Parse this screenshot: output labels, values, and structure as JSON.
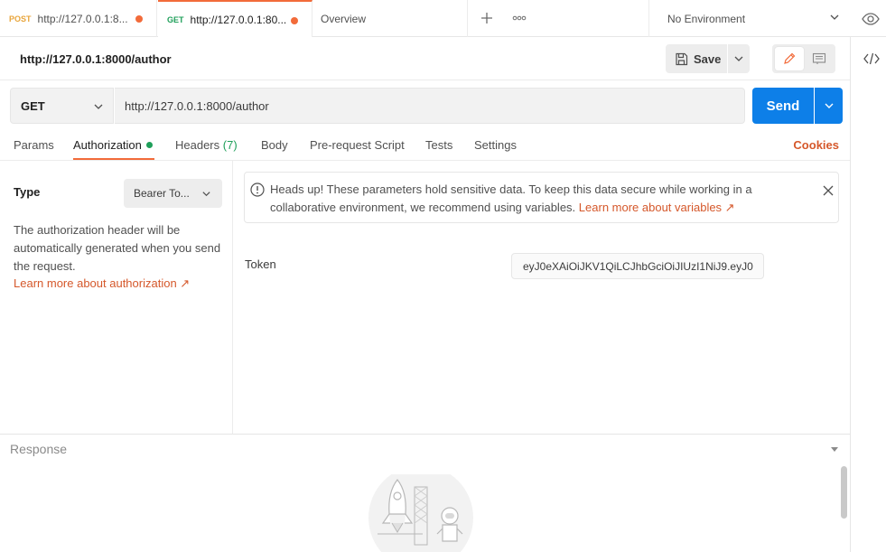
{
  "tabs": [
    {
      "method": "POST",
      "label": "http://127.0.0.1:8..."
    },
    {
      "method": "GET",
      "label": "http://127.0.0.1:80..."
    },
    {
      "label": "Overview"
    }
  ],
  "environment": {
    "label": "No Environment"
  },
  "request": {
    "title": "http://127.0.0.1:8000/author",
    "save_label": "Save",
    "method": "GET",
    "url": "http://127.0.0.1:8000/author",
    "send_label": "Send"
  },
  "subtabs": {
    "params": "Params",
    "authorization": "Authorization",
    "headers": "Headers",
    "headers_count": "(7)",
    "body": "Body",
    "prerequest": "Pre-request Script",
    "tests": "Tests",
    "settings": "Settings",
    "cookies": "Cookies"
  },
  "auth": {
    "type_label": "Type",
    "type_value": "Bearer To...",
    "description": "The authorization header will be automatically generated when you send the request.",
    "learn_more": "Learn more about authorization ↗",
    "notice_text": "Heads up! These parameters hold sensitive data. To keep this data secure while working in a collaborative environment, we recommend using variables.",
    "notice_link": "Learn more about variables ↗",
    "token_label": "Token",
    "token_value": "eyJ0eXAiOiJKV1QiLCJhbGciOiJIUzI1NiJ9.eyJ0"
  },
  "response": {
    "title": "Response"
  },
  "colors": {
    "accent": "#f26b3a",
    "send": "#0d7fe8",
    "link": "#d5582b",
    "success": "#1f9f5a"
  }
}
